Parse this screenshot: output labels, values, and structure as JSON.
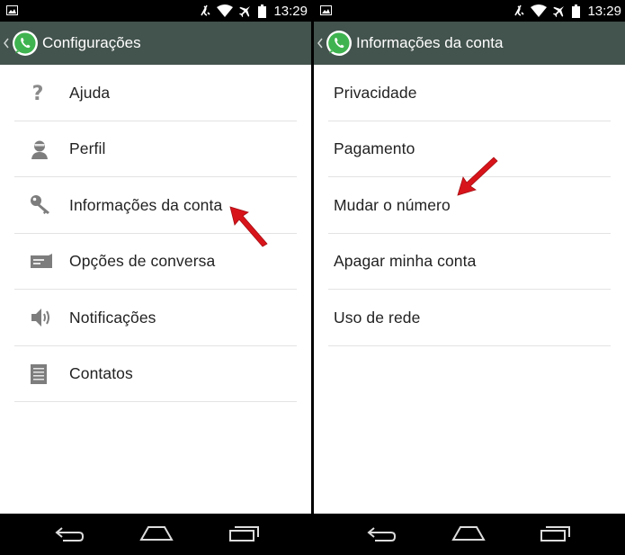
{
  "status": {
    "time": "13:29"
  },
  "left": {
    "title": "Configurações",
    "items": [
      {
        "label": "Ajuda",
        "icon": "question-icon"
      },
      {
        "label": "Perfil",
        "icon": "profile-icon"
      },
      {
        "label": "Informações da conta",
        "icon": "key-icon"
      },
      {
        "label": "Opções de conversa",
        "icon": "chat-icon"
      },
      {
        "label": "Notificações",
        "icon": "speaker-icon"
      },
      {
        "label": "Contatos",
        "icon": "contacts-icon"
      }
    ]
  },
  "right": {
    "title": "Informações da conta",
    "items": [
      {
        "label": "Privacidade"
      },
      {
        "label": "Pagamento"
      },
      {
        "label": "Mudar o número"
      },
      {
        "label": "Apagar minha conta"
      },
      {
        "label": "Uso de rede"
      }
    ]
  },
  "colors": {
    "actionbar": "#43534d",
    "accent_arrow": "#d8141b",
    "whatsapp_green": "#3fb34f"
  }
}
